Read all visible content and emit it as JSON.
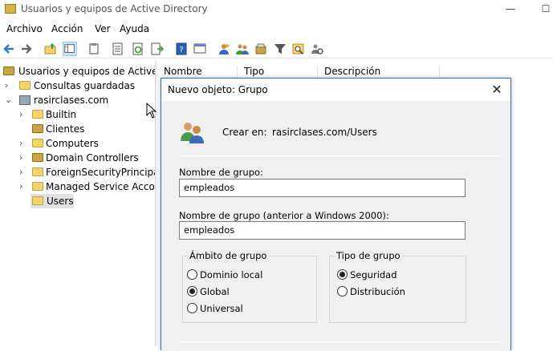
{
  "window": {
    "title": "Usuarios y equipos de Active Directory",
    "minimize_glyph": "—",
    "maximize_glyph": "☐"
  },
  "menu": [
    "Archivo",
    "Acción",
    "Ver",
    "Ayuda"
  ],
  "toolbar_icons": [
    "back-icon",
    "forward-icon",
    "up-folder-icon",
    "show-tree-icon",
    "clipboard-icon",
    "properties-icon",
    "refresh-icon",
    "export-icon",
    "help-icon",
    "console-tree-icon",
    "new-user-icon",
    "new-group-icon",
    "new-ou-icon",
    "filter-icon",
    "find-icon",
    "add-to-group-icon"
  ],
  "tree": {
    "root": "Usuarios y equipos de Active Directory",
    "saved_queries": "Consultas guardadas",
    "domain": "rasirclases.com",
    "children": [
      "Builtin",
      "Clientes",
      "Computers",
      "Domain Controllers",
      "ForeignSecurityPrincipals",
      "Managed Service Accounts",
      "Users"
    ],
    "selected": "Users"
  },
  "list_columns": [
    "Nombre",
    "Tipo",
    "Descripción"
  ],
  "dialog": {
    "title": "Nuevo objeto: Grupo",
    "close_glyph": "✕",
    "create_in_label": "Crear en:",
    "create_in_value": "rasirclases.com/Users",
    "group_name_label": "Nombre de grupo:",
    "group_name_value": "empleados",
    "pre2000_label": "Nombre de grupo (anterior a Windows 2000):",
    "pre2000_value": "empleados",
    "scope": {
      "title": "Ámbito de grupo",
      "options": [
        "Dominio local",
        "Global",
        "Universal"
      ],
      "selected": "Global"
    },
    "type": {
      "title": "Tipo de grupo",
      "options": [
        "Seguridad",
        "Distribución"
      ],
      "selected": "Seguridad"
    }
  },
  "colors": {
    "dialog_border": "#2a6fbf",
    "toolbar_selected": "#cce4f7",
    "folder": "#f3d36b"
  }
}
